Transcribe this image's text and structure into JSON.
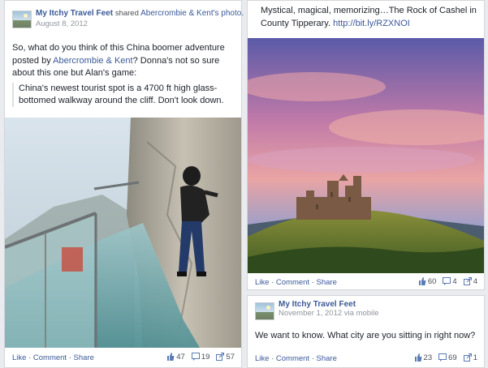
{
  "colors": {
    "link": "#3b5998",
    "meta": "#90949c",
    "background": "#e9ebee"
  },
  "left_post": {
    "author": "My Itchy Travel Feet",
    "action": "shared",
    "source": "Abercrombie & Kent's photo.",
    "date": "August 8, 2012",
    "text_part1": "So, what do you think of this China boomer adventure posted by ",
    "text_link": "Abercrombie & Kent",
    "text_part2": "? Donna's not so sure about this one but Alan's game:",
    "quote": "China's newest tourist spot is a 4700 ft high glass-bottomed walkway around the cliff. Don't look down.",
    "actions": {
      "like": "Like",
      "comment": "Comment",
      "share": "Share",
      "sep": " · "
    },
    "counts": {
      "likes": "47",
      "comments": "19",
      "shares": "57"
    }
  },
  "right_top_post": {
    "text": "Mystical, magical, memorizing…The Rock of Cashel in County Tipperary.",
    "link": "http://bit.ly/RZXNOI",
    "actions": {
      "like": "Like",
      "comment": "Comment",
      "share": "Share",
      "sep": " · "
    },
    "counts": {
      "likes": "60",
      "comments": "4",
      "shares": "4"
    }
  },
  "right_bottom_post": {
    "author": "My Itchy Travel Feet",
    "date": "November 1, 2012 via mobile",
    "text": "We want to know. What city are you sitting in right now?",
    "actions": {
      "like": "Like",
      "comment": "Comment",
      "share": "Share",
      "sep": " · "
    },
    "counts": {
      "likes": "23",
      "comments": "69",
      "shares": "1"
    }
  },
  "icons": [
    "thumbs-up-icon",
    "comment-icon",
    "share-icon"
  ]
}
